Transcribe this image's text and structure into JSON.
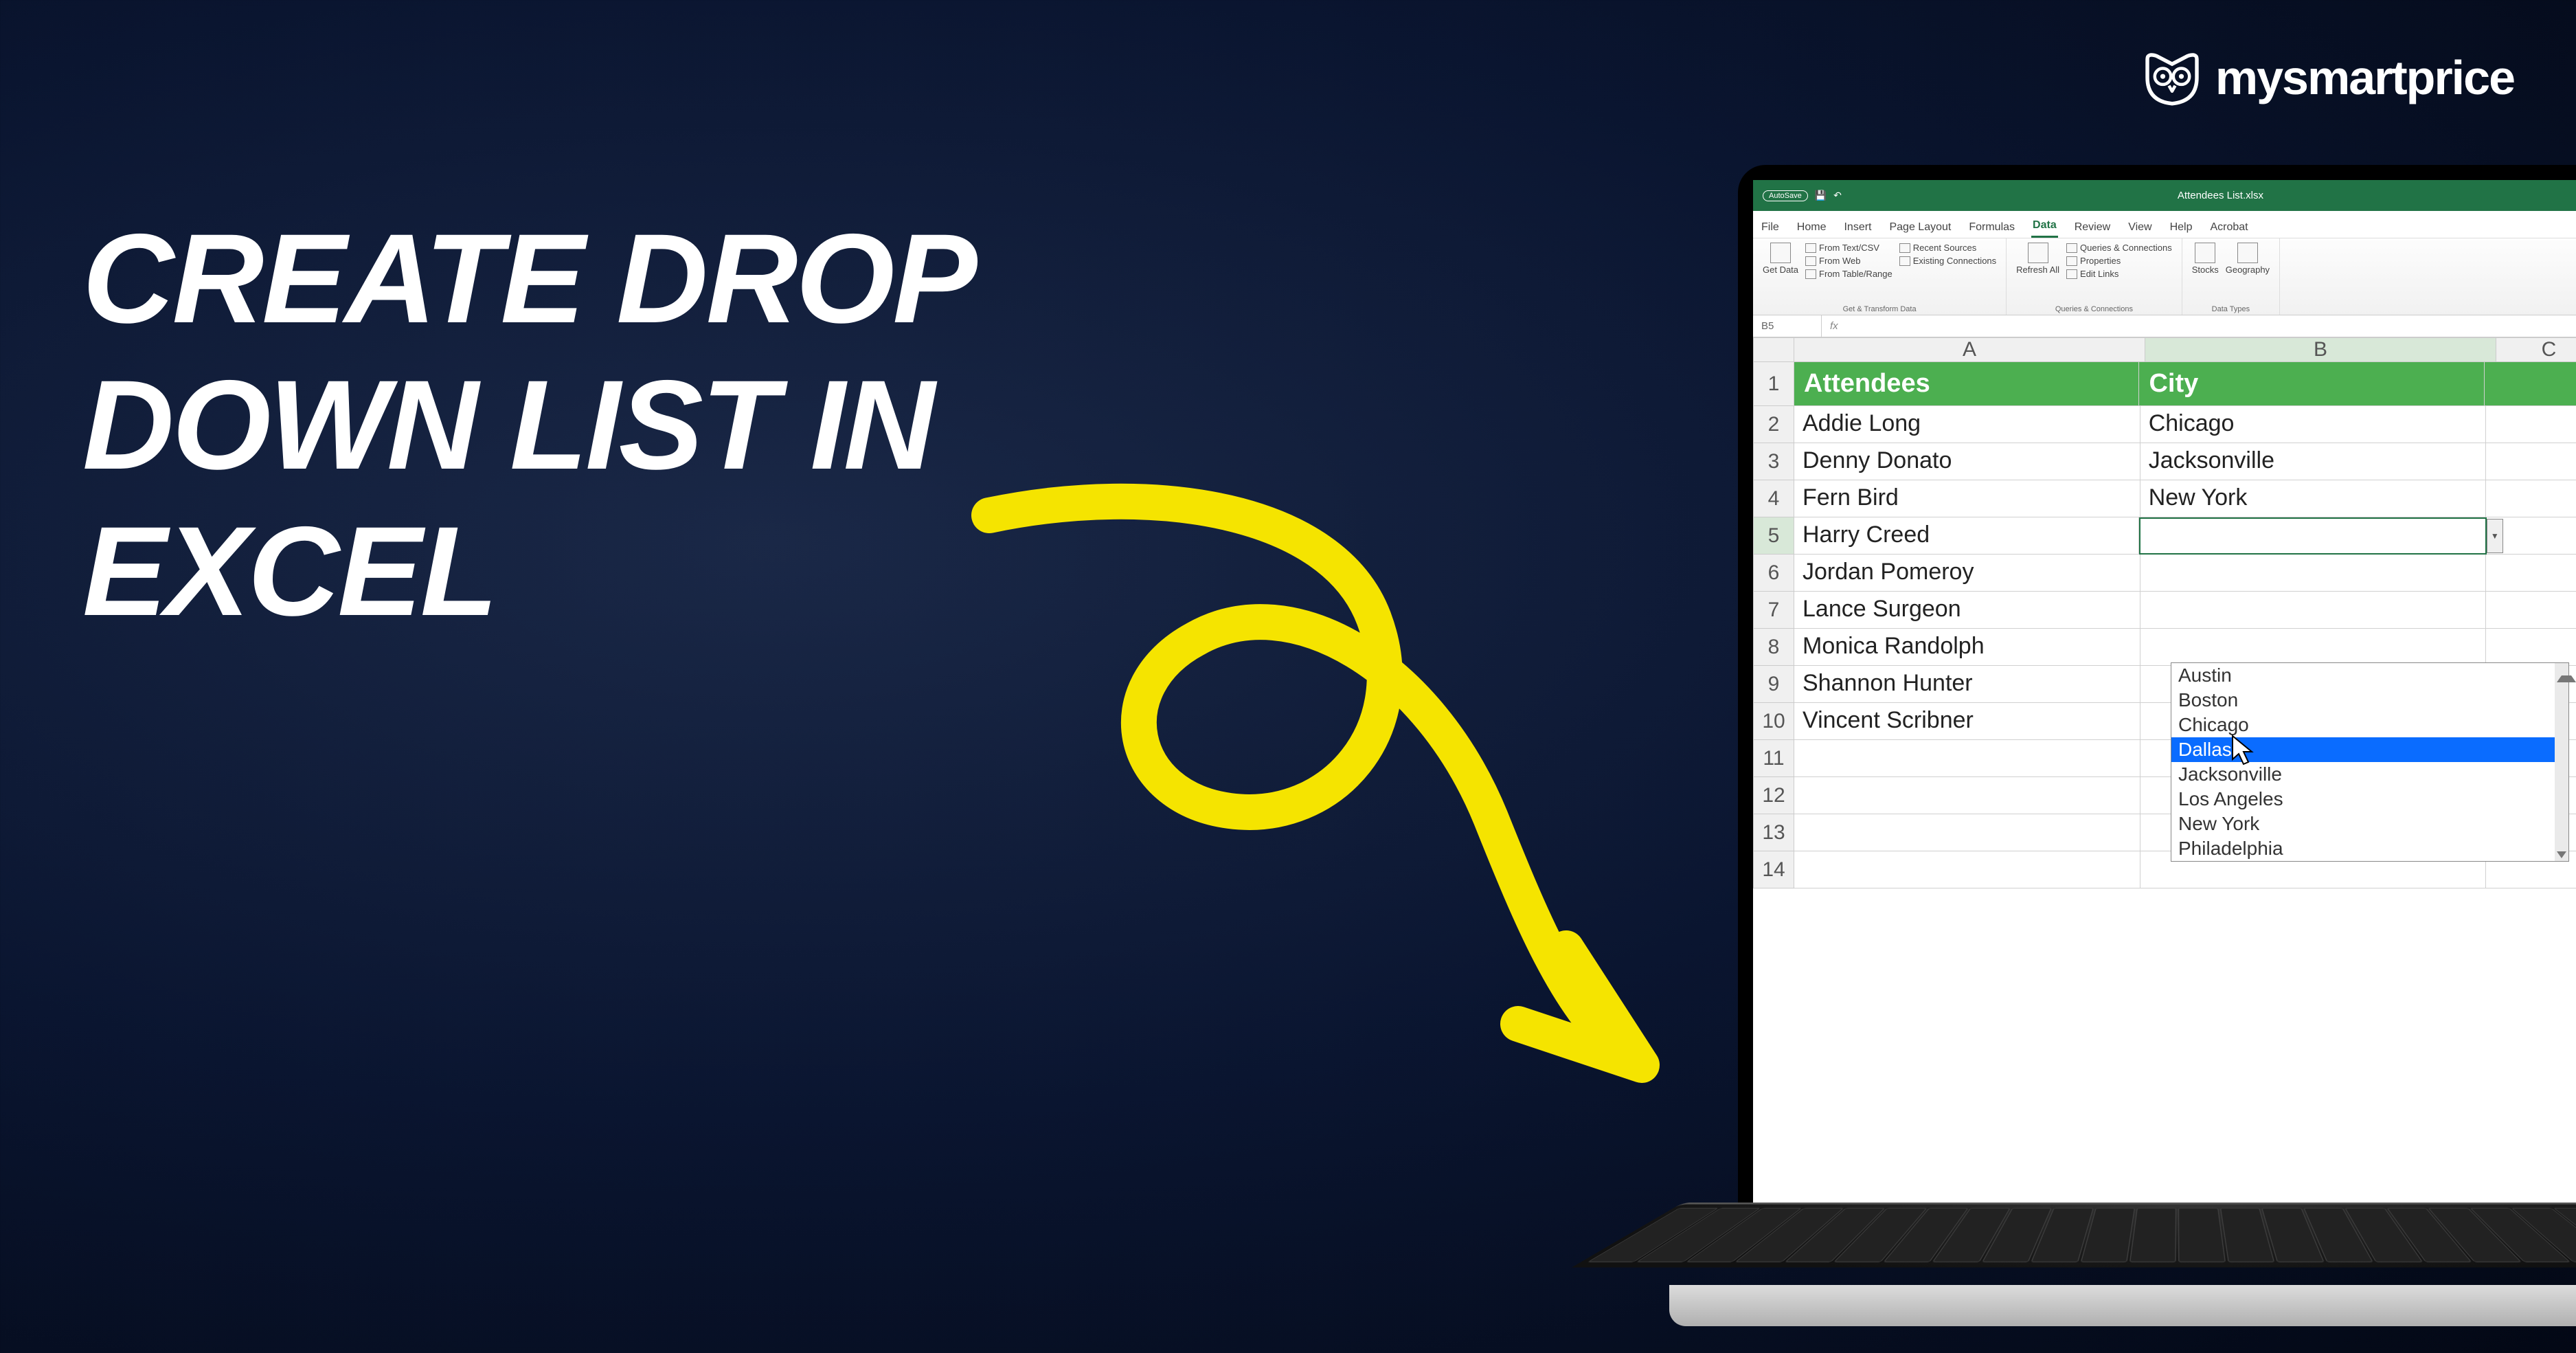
{
  "headline": "CREATE DROP DOWN LIST IN EXCEL",
  "logo_text": "mysmartprice",
  "excel": {
    "autosave": "AutoSave",
    "title": "Attendees List.xlsx",
    "tabs": [
      "File",
      "Home",
      "Insert",
      "Page Layout",
      "Formulas",
      "Data",
      "Review",
      "View",
      "Help",
      "Acrobat"
    ],
    "active_tab": "Data",
    "ribbon": {
      "get_data": "Get Data",
      "from_text": "From Text/CSV",
      "from_web": "From Web",
      "from_table": "From Table/Range",
      "recent": "Recent Sources",
      "existing": "Existing Connections",
      "group1_label": "Get & Transform Data",
      "refresh": "Refresh All",
      "queries": "Queries & Connections",
      "properties": "Properties",
      "edit_links": "Edit Links",
      "group2_label": "Queries & Connections",
      "stocks": "Stocks",
      "geography": "Geography",
      "group3_label": "Data Types"
    },
    "namebox": "B5",
    "columns": [
      "A",
      "B",
      "C"
    ],
    "rows": [
      {
        "n": 1,
        "a": "Attendees",
        "b": "City",
        "header": true
      },
      {
        "n": 2,
        "a": "Addie Long",
        "b": "Chicago"
      },
      {
        "n": 3,
        "a": "Denny Donato",
        "b": "Jacksonville"
      },
      {
        "n": 4,
        "a": "Fern Bird",
        "b": "New York"
      },
      {
        "n": 5,
        "a": "Harry Creed",
        "b": "",
        "selected": true
      },
      {
        "n": 6,
        "a": "Jordan Pomeroy",
        "b": ""
      },
      {
        "n": 7,
        "a": "Lance Surgeon",
        "b": ""
      },
      {
        "n": 8,
        "a": "Monica Randolph",
        "b": ""
      },
      {
        "n": 9,
        "a": "Shannon Hunter",
        "b": ""
      },
      {
        "n": 10,
        "a": "Vincent Scribner",
        "b": ""
      },
      {
        "n": 11,
        "a": "",
        "b": ""
      },
      {
        "n": 12,
        "a": "",
        "b": ""
      },
      {
        "n": 13,
        "a": "",
        "b": ""
      },
      {
        "n": 14,
        "a": "",
        "b": ""
      }
    ],
    "dropdown_options": [
      "Austin",
      "Boston",
      "Chicago",
      "Dallas",
      "Jacksonville",
      "Los Angeles",
      "New York",
      "Philadelphia"
    ],
    "dropdown_selected": "Dallas"
  }
}
